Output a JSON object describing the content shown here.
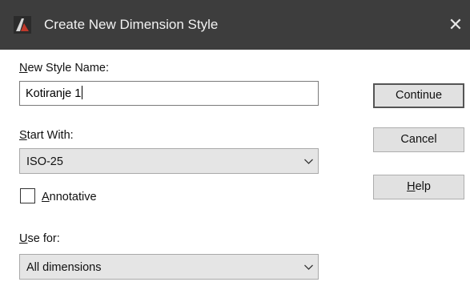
{
  "window": {
    "title": "Create New Dimension Style",
    "close_glyph": "✕"
  },
  "form": {
    "new_style_name": {
      "label_accel": "N",
      "label_rest": "ew Style Name:",
      "value": "Kotiranje 1"
    },
    "start_with": {
      "label_accel": "S",
      "label_rest": "tart With:",
      "value": "ISO-25"
    },
    "annotative": {
      "label_accel": "A",
      "label_rest": "nnotative",
      "checked": false
    },
    "use_for": {
      "label_accel": "U",
      "label_rest": "se for:",
      "value": "All dimensions"
    }
  },
  "buttons": {
    "continue_label": "Continue",
    "cancel_label": "Cancel",
    "help_accel": "H",
    "help_rest": "elp"
  },
  "icons": {
    "app": "autocad-logo-icon",
    "close": "close-icon",
    "dropdown": "chevron-down-icon"
  },
  "colors": {
    "titlebar": "#3d3d3d",
    "button_face": "#e1e1e1",
    "combo_face": "#e5e5e5"
  }
}
